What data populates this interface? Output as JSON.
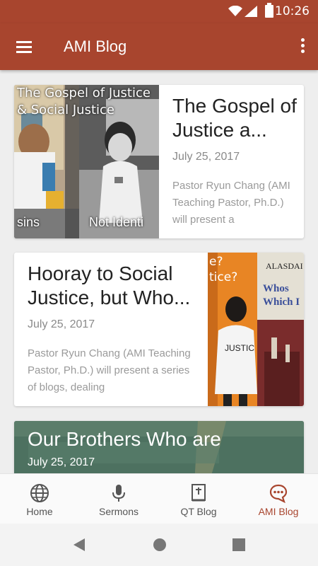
{
  "status_bar": {
    "time": "10:26"
  },
  "app_bar": {
    "title": "AMI Blog"
  },
  "posts": [
    {
      "title": "The Gospel of Justice a...",
      "date": "July 25, 2017",
      "excerpt": "Pastor Ryun Chang (AMI Teaching Pastor, Ph.D.) will present a",
      "thumb_caption_top": "The Gospel of Justice & Social Justice",
      "thumb_caption_left": "sins",
      "thumb_caption_right": "Not Identi"
    },
    {
      "title": "Hooray to Social Justice, but Who...",
      "date": "July 25, 2017",
      "excerpt": "Pastor Ryun Chang (AMI Teaching Pastor, Ph.D.) will present a series of blogs, dealing",
      "thumb_caption_left": "e? tice?",
      "thumb_caption_book": "ALASDAI",
      "thumb_caption_book2": "Whos Which I",
      "thumb_caption_shirt": "JUSTIC"
    },
    {
      "title": "Our Brothers Who are",
      "date": "July 25, 2017"
    }
  ],
  "bottom_nav": {
    "items": [
      {
        "label": "Home",
        "icon": "globe-icon"
      },
      {
        "label": "Sermons",
        "icon": "microphone-icon"
      },
      {
        "label": "QT Blog",
        "icon": "bible-icon"
      },
      {
        "label": "AMI Blog",
        "icon": "chat-bubble-icon"
      }
    ],
    "active_index": 3
  },
  "colors": {
    "primary": "#a8452e",
    "nav_inactive": "#555555"
  }
}
